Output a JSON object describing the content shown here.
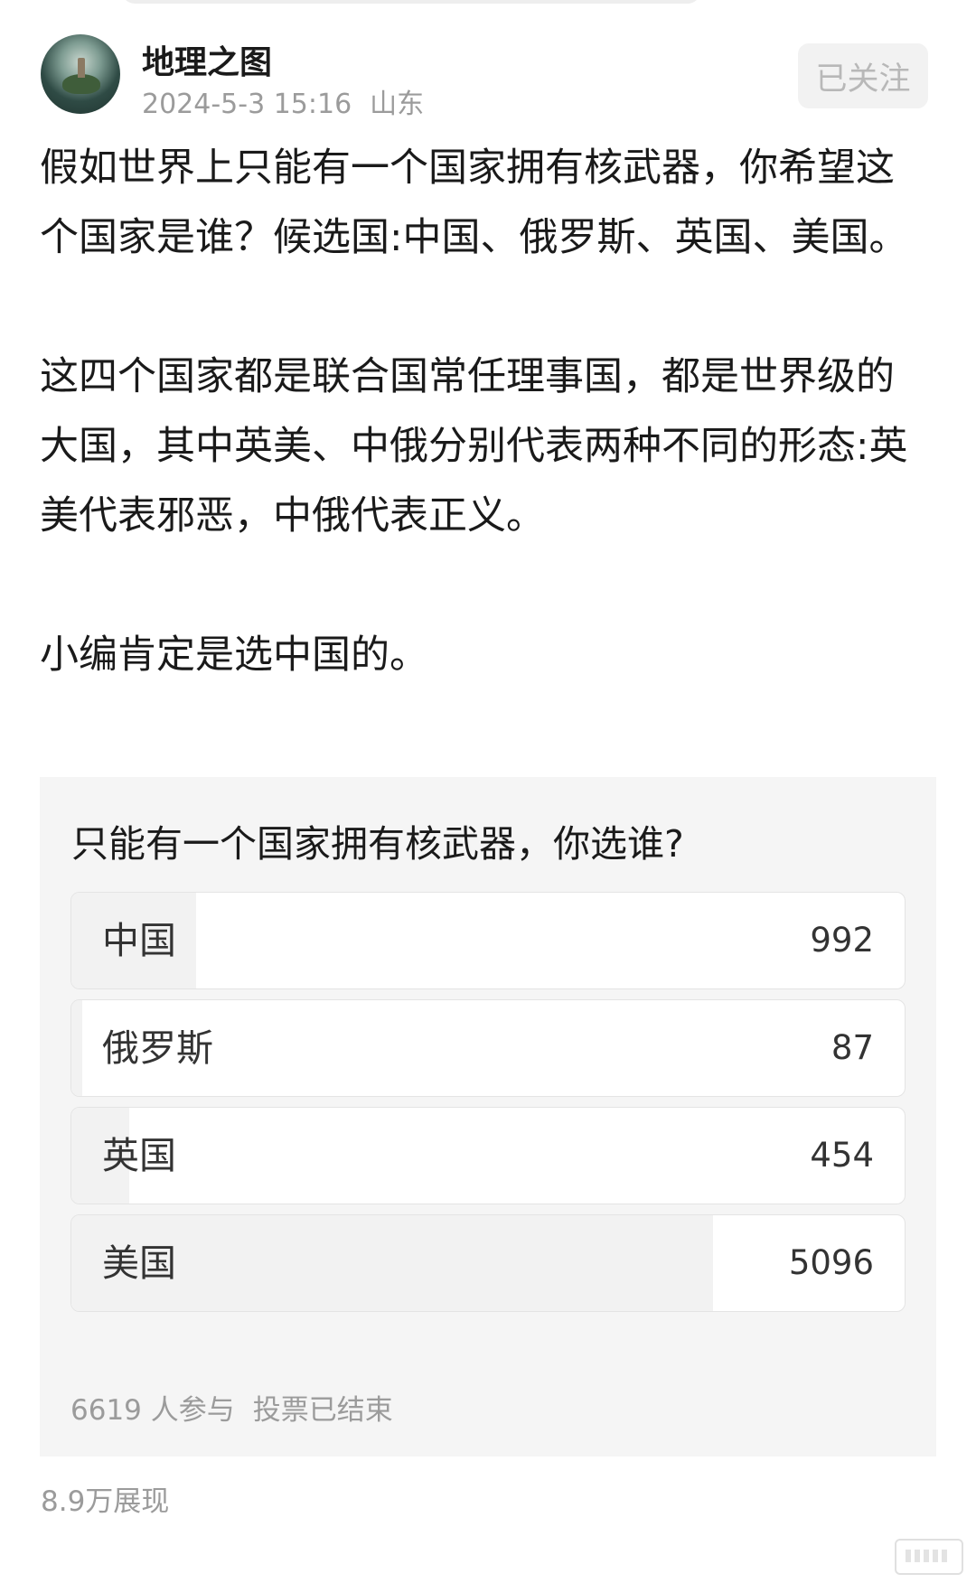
{
  "author": {
    "name": "地理之图",
    "timestamp": "2024-5-3 15:16",
    "location": "山东"
  },
  "follow_label": "已关注",
  "post": {
    "paragraphs": [
      "假如世界上只能有一个国家拥有核武器，你希望这个国家是谁？候选国:中国、俄罗斯、英国、美国。",
      "这四个国家都是联合国常任理事国，都是世界级的大国，其中英美、中俄分别代表两种不同的形态:英美代表邪恶，中俄代表正义。",
      "小编肯定是选中国的。"
    ]
  },
  "poll": {
    "question": "只能有一个国家拥有核武器，你选谁?",
    "options": [
      {
        "label": "中国",
        "count": "992",
        "share": 0.15
      },
      {
        "label": "俄罗斯",
        "count": "87",
        "share": 0.013
      },
      {
        "label": "英国",
        "count": "454",
        "share": 0.069
      },
      {
        "label": "美国",
        "count": "5096",
        "share": 0.77
      }
    ],
    "participants": "6619 人参与",
    "status": "投票已结束"
  },
  "views": "8.9万展现",
  "icons": {
    "avatar": "island-castle-avatar",
    "watermark": "weibo-watermark-icon"
  }
}
